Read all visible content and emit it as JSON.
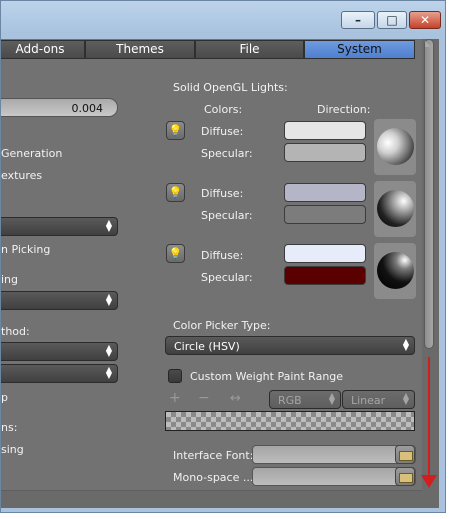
{
  "window": {
    "minimize_icon": "minimize-icon",
    "maximize_icon": "maximize-icon",
    "close_icon": "close-icon"
  },
  "tabs": [
    {
      "label": "Add-ons",
      "active": false
    },
    {
      "label": "Themes",
      "active": false
    },
    {
      "label": "File",
      "active": false
    },
    {
      "label": "System",
      "active": true
    }
  ],
  "left_panel": {
    "number_value": "0.004",
    "generation_label": "Generation",
    "textures_label": "extures",
    "picking_label": "n Picking",
    "ing_label": "ing",
    "method_label": "thod:",
    "p_label": "p",
    "ns_label": "ns:",
    "sing_label": "sing"
  },
  "opengl_lights": {
    "title": "Solid OpenGL Lights:",
    "colors_header": "Colors:",
    "direction_header": "Direction:",
    "lights": [
      {
        "diffuse_label": "Diffuse:",
        "specular_label": "Specular:",
        "diffuse_color": "#e5e5e5",
        "specular_color": "#b4b4b4"
      },
      {
        "diffuse_label": "Diffuse:",
        "specular_label": "Specular:",
        "diffuse_color": "#b4b6c8",
        "specular_color": "#7c7c7c"
      },
      {
        "diffuse_label": "Diffuse:",
        "specular_label": "Specular:",
        "diffuse_color": "#e6ecfa",
        "specular_color": "#5a0000"
      }
    ]
  },
  "color_picker": {
    "label": "Color Picker Type:",
    "value": "Circle (HSV)"
  },
  "weight_paint": {
    "label": "Custom Weight Paint Range",
    "checked": false,
    "color_mode": "RGB",
    "interpolation": "Linear"
  },
  "fonts": {
    "interface_label": "Interface Font:",
    "monospace_label": "Mono-space ..."
  },
  "colors": {
    "accent_tab": "#5b8bd8",
    "annotation_arrow": "#d21e1e"
  }
}
